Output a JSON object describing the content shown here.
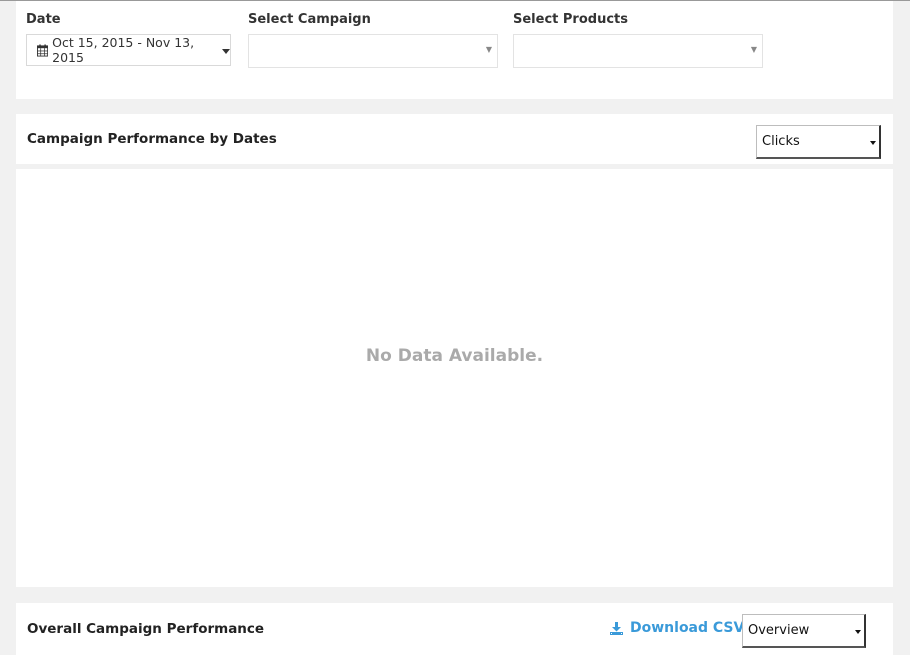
{
  "filters": {
    "date_label": "Date",
    "date_range": "Oct 15, 2015 - Nov 13, 2015",
    "campaign_label": "Select Campaign",
    "campaign_value": "",
    "products_label": "Select Products",
    "products_value": ""
  },
  "chart_panel": {
    "title": "Campaign Performance by Dates",
    "metric_selected": "Clicks",
    "empty_message": "No Data Available."
  },
  "overall_panel": {
    "title": "Overall Campaign Performance",
    "download_label": "Download CSV",
    "view_selected": "Overview"
  },
  "colors": {
    "background": "#f1f1f1",
    "panel": "#ffffff",
    "link_accent": "#3a9ad9",
    "empty_text": "#aaaaaa"
  },
  "icons": {
    "date": "calendar-icon",
    "download": "download-icon"
  }
}
